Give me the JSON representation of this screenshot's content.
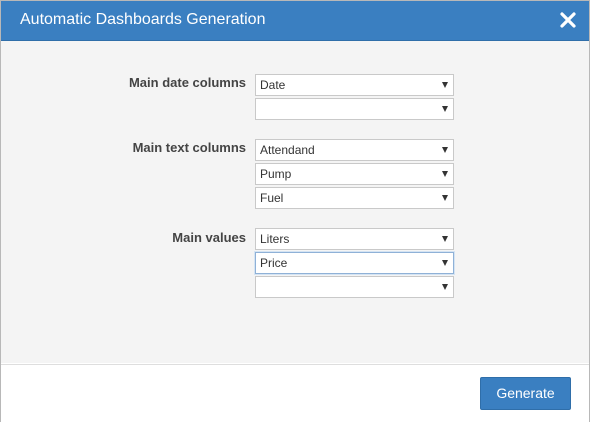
{
  "dialog": {
    "title": "Automatic Dashboards Generation",
    "close_icon": "close-icon"
  },
  "form": {
    "groups": [
      {
        "label": "Main date columns",
        "selects": [
          {
            "value": ""
          },
          {
            "value": ""
          }
        ]
      },
      {
        "label": "Main text columns",
        "selects": [
          {
            "value": ""
          },
          {
            "value": ""
          },
          {
            "value": ""
          }
        ]
      },
      {
        "label": "Main values",
        "selects": [
          {
            "value": ""
          },
          {
            "value": ""
          },
          {
            "value": ""
          }
        ]
      }
    ]
  },
  "footer": {
    "generate_label": "Generate"
  },
  "colors": {
    "header": "#3a7fc1",
    "button": "#3a7fc1",
    "body_bg": "#f4f4f4"
  }
}
